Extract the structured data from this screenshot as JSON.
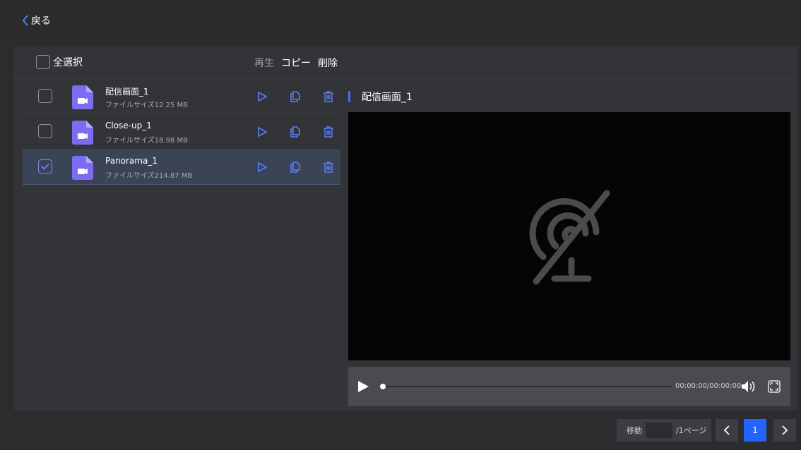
{
  "header": {
    "back_label": "戻る"
  },
  "toolbar": {
    "select_all_label": "全選択",
    "play_label": "再生",
    "copy_label": "コピー",
    "delete_label": "削除"
  },
  "files": [
    {
      "name": "配信画面_1",
      "size": "ファイルサイズ12.25 MB",
      "checked": false
    },
    {
      "name": "Close-up_1",
      "size": "ファイルサイズ18.98 MB",
      "checked": false
    },
    {
      "name": "Panorama_1",
      "size": "ファイルサイズ214.87 MB",
      "checked": true
    }
  ],
  "preview": {
    "title": "配信画面_1",
    "time": "00:00:00/00:00:00",
    "progress": 0
  },
  "pagination": {
    "goto_label": "移動",
    "goto_value": "",
    "total_label": "/1ページ",
    "current_page": "1"
  },
  "colors": {
    "accent": "#2463ff",
    "file_icon": "#7b6cf2",
    "action_icon": "#5b7cff",
    "background": "#2b2c2e"
  }
}
